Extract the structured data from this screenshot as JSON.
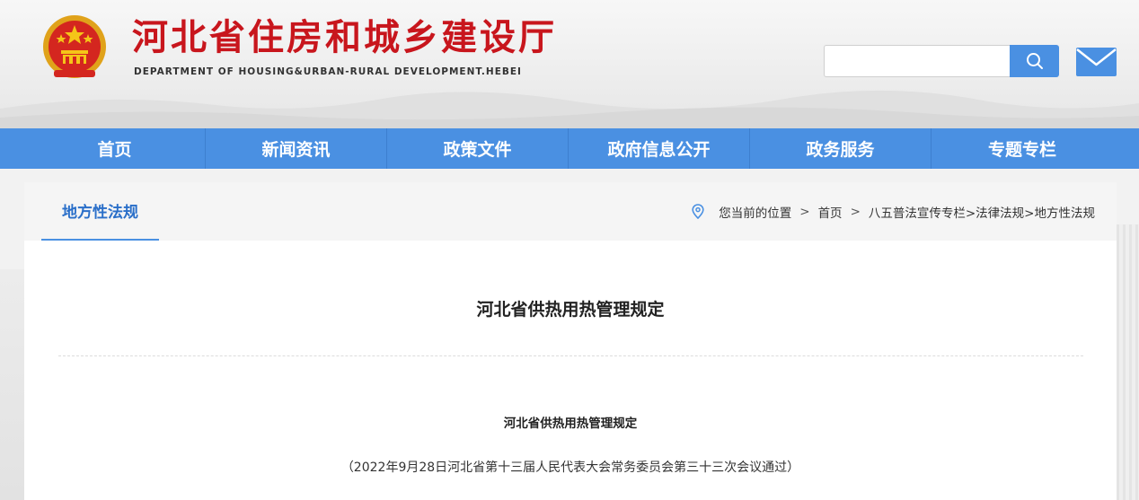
{
  "header": {
    "title": "河北省住房和城乡建设厅",
    "subtitle": "DEPARTMENT OF HOUSING&URBAN-RURAL DEVELOPMENT.HEBEI",
    "search_value": "",
    "emblem_icon": "national-emblem",
    "search_icon": "search-icon",
    "mail_icon": "mail-icon",
    "brand_color": "#c8161d"
  },
  "nav": {
    "accent_color": "#4a90e2",
    "items": [
      "首页",
      "新闻资讯",
      "政策文件",
      "政府信息公开",
      "政务服务",
      "专题专栏"
    ]
  },
  "section": {
    "tab_label": "地方性法规"
  },
  "breadcrumb": {
    "prefix": "您当前的位置",
    "home": "首页",
    "path": "八五普法宣传专栏>法律法规>地方性法规"
  },
  "article": {
    "title": "河北省供热用热管理规定",
    "doc_heading": "河北省供热用热管理规定",
    "doc_note": "（2022年9月28日河北省第十三届人民代表大会常务委员会第三十三次会议通过）"
  }
}
